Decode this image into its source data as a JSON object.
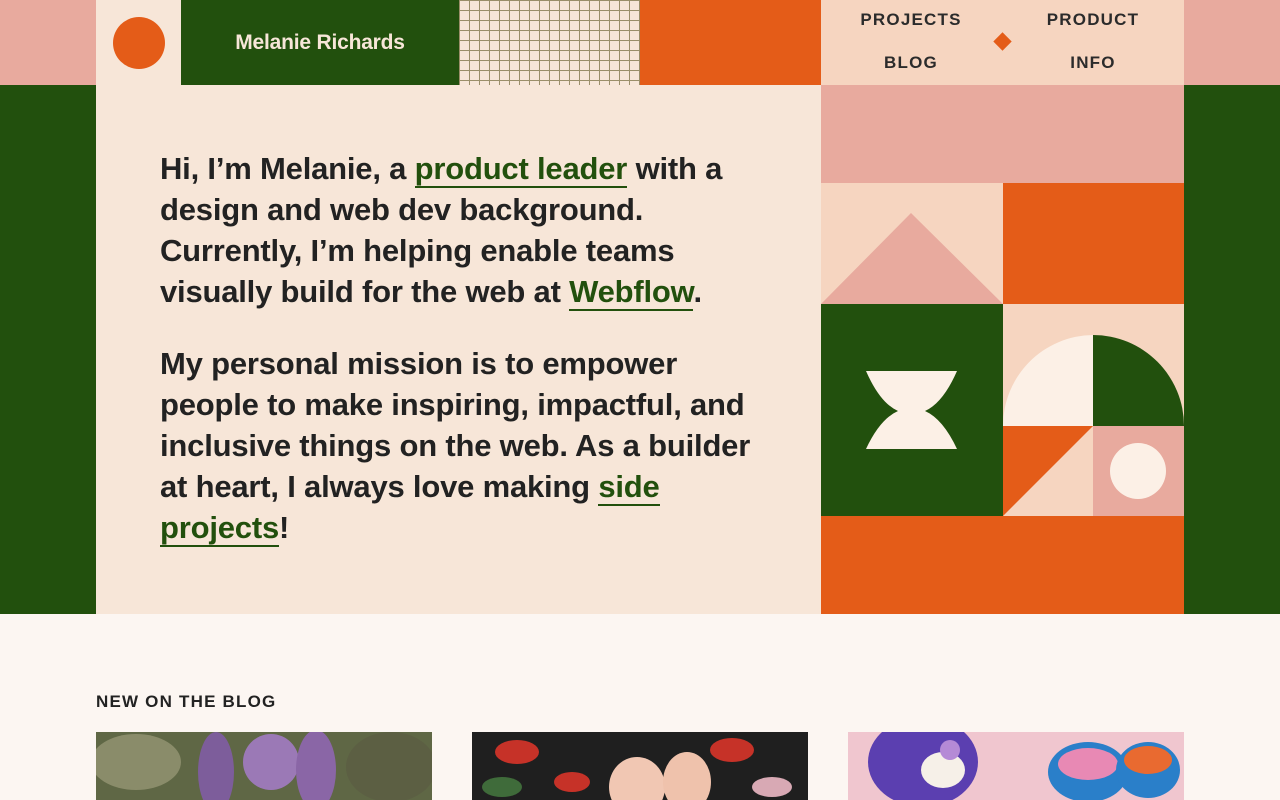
{
  "header": {
    "site_name": "Melanie Richards",
    "nav": {
      "projects": "PROJECTS",
      "blog": "BLOG",
      "product": "PRODUCT",
      "info": "INFO"
    }
  },
  "hero": {
    "p1_before": "Hi, I’m Melanie, a ",
    "p1_link": "product leader",
    "p1_middle": " with a design and web dev background. Currently, I’m helping enable teams visually build for the web at ",
    "p1_link2": "Webflow",
    "p1_end": ".",
    "p2_before": "My personal mission is to empower people to make inspiring, impactful, and inclusive things on the web. As a builder at heart, I always love making ",
    "p2_link": "side projects",
    "p2_end": "!"
  },
  "blog": {
    "heading": "NEW ON THE BLOG"
  },
  "colors": {
    "dark_green": "#22500d",
    "orange": "#e45c18",
    "pink": "#e8aa9e",
    "cream": "#f7e6d8",
    "peach": "#f6d5c0",
    "off_white": "#fcf6f2"
  }
}
